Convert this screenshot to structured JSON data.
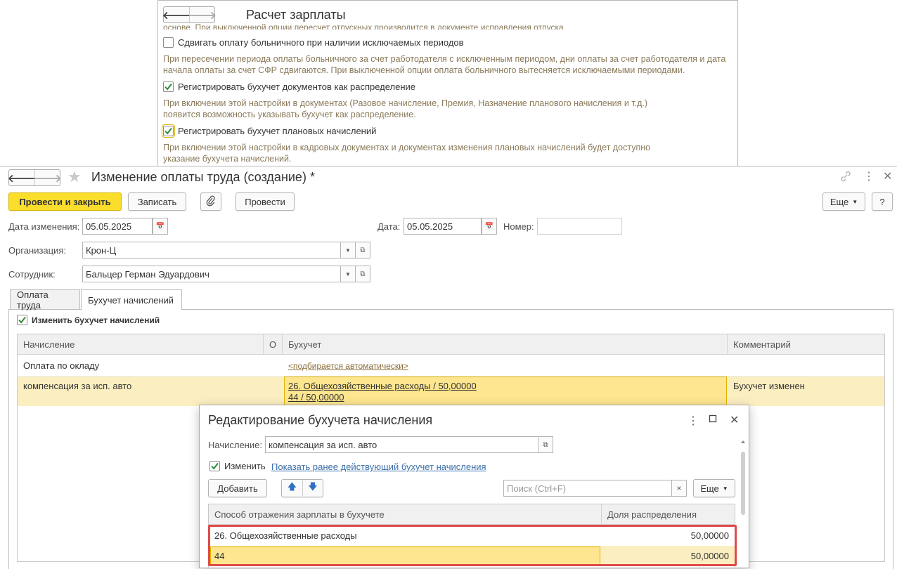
{
  "settings": {
    "title": "Расчет зарплаты",
    "cut_text": "основе. При выключенной опции пересчет отпускных производится в документе исправления отпуска.",
    "options": [
      {
        "label": "Сдвигать оплату больничного при наличии исключаемых периодов",
        "checked": false,
        "hint": "При пересечении периода оплаты больничного за счет работодателя с исключенным периодом, дни оплаты за счет работодателя и дата начала оплаты за счет СФР сдвигаются. При выключенной опции оплата больничного вытесняется исключаемыми периодами."
      },
      {
        "label": "Регистрировать бухучет документов как распределение",
        "checked": true,
        "hint": "При включении этой настройки в документах (Разовое начисление, Премия, Назначение  планового начисления и т.д.) появится возможность указывать бухучет как распределение."
      },
      {
        "label": "Регистрировать бухучет плановых начислений",
        "checked": true,
        "hint": "При включении этой настройки в кадровых документах и документах изменения плановых начислений будет доступно указание бухучета начислений."
      }
    ]
  },
  "doc": {
    "title": "Изменение оплаты труда (создание) *",
    "toolbar": {
      "post_close": "Провести и закрыть",
      "save": "Записать",
      "post": "Провести",
      "more": "Еще",
      "help": "?"
    },
    "fields": {
      "change_date_label": "Дата изменения:",
      "change_date": "05.05.2025",
      "date_label": "Дата:",
      "date": "05.05.2025",
      "number_label": "Номер:",
      "number": "",
      "org_label": "Организация:",
      "org": "Крон-Ц",
      "employee_label": "Сотрудник:",
      "employee": "Бальцер Герман Эдуардович"
    },
    "tabs": [
      "Оплата труда",
      "Бухучет начислений"
    ],
    "active_tab": 1,
    "change_accounting_label": "Изменить бухучет начислений",
    "grid": {
      "headers": [
        "Начисление",
        "О",
        "Бухучет",
        "Комментарий"
      ],
      "rows": [
        {
          "accrual": "Оплата по окладу",
          "accounting": [
            "<подбирается автоматически>"
          ],
          "comment": ""
        },
        {
          "accrual": "компенсация за исп. авто",
          "accounting": [
            "26. Общехозяйственные расходы / 50,00000",
            "44 / 50,00000"
          ],
          "comment": "Бухучет изменен"
        }
      ]
    }
  },
  "dialog": {
    "title": "Редактирование бухучета начисления",
    "accrual_label": "Начисление:",
    "accrual_value": "компенсация за исп. авто",
    "change_label": "Изменить",
    "show_prev_link": "Показать ранее действующий бухучет начисления",
    "add_button": "Добавить",
    "search_placeholder": "Поиск (Ctrl+F)",
    "more": "Еще",
    "headers": [
      "Способ отражения зарплаты в бухучете",
      "Доля распределения"
    ],
    "rows": [
      {
        "method": "26. Общехозяйственные расходы",
        "share": "50,00000"
      },
      {
        "method": "44",
        "share": "50,00000"
      }
    ]
  },
  "colors": {
    "accent_yellow": "#fbde2c",
    "selected_row": "#fbeec0",
    "highlight_box": "#e04a4a",
    "link": "#3b6fa8"
  }
}
